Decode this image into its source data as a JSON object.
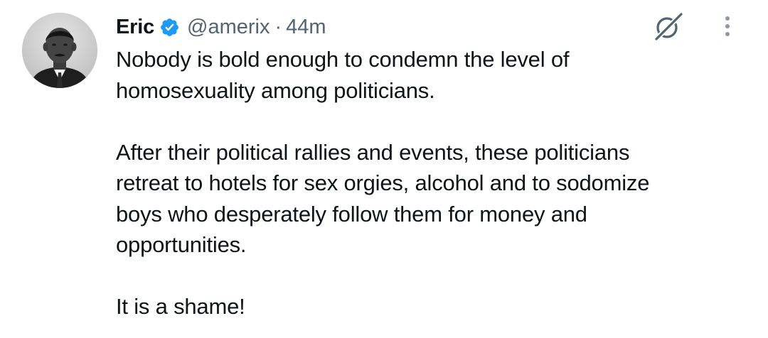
{
  "tweet": {
    "author": {
      "name": "Eric",
      "handle": "@amerix",
      "separator": "·",
      "time": "44m",
      "verified": true
    },
    "icons": {
      "verified": "verified-badge-icon",
      "grok": "grok-icon",
      "more": "more-options-icon"
    },
    "colors": {
      "verified": "#1d9bf0",
      "secondary_text": "#536471",
      "primary_text": "#0f1419"
    },
    "paragraphs": [
      {
        "lines": [
          "Nobody is bold enough to condemn the level of",
          "homosexuality among politicians."
        ]
      },
      {
        "lines": [
          "After their political rallies and events, these politicians",
          "retreat to hotels for sex orgies, alcohol and to sodomize",
          "boys who desperately follow them for money and",
          "opportunities."
        ]
      },
      {
        "lines": [
          "It is a shame!"
        ]
      }
    ]
  }
}
